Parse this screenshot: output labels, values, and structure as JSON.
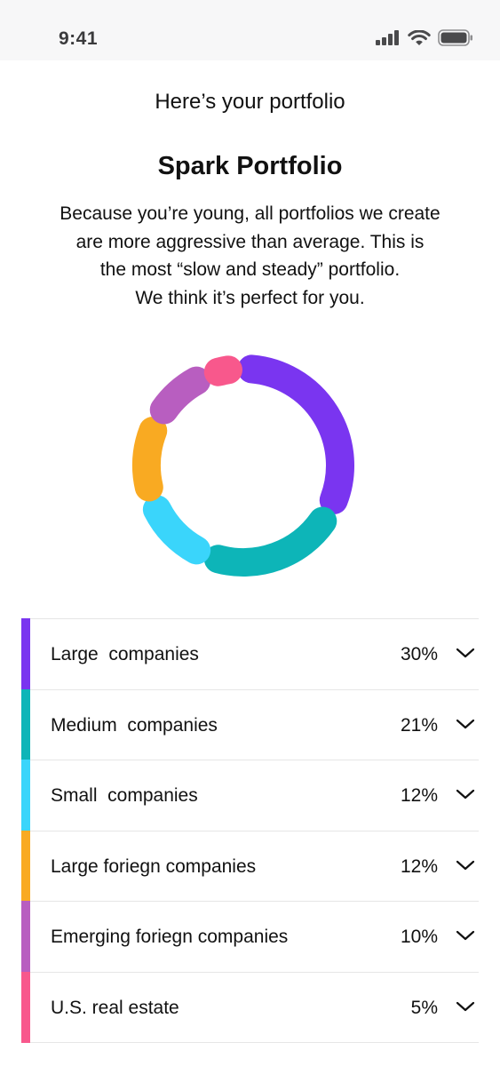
{
  "status": {
    "time": "9:41"
  },
  "header": {
    "title": "Here’s your portfolio"
  },
  "portfolio": {
    "name": "Spark Portfolio",
    "description_lines": [
      "Because you’re young, all portfolios we create",
      "are more aggressive than average. This is",
      "the most “slow and steady” portfolio.",
      "We think it’s perfect for you."
    ]
  },
  "icons": [
    "signal-icon",
    "wifi-icon",
    "battery-icon",
    "chevron-down-icon"
  ],
  "allocations": [
    {
      "label": "Large  companies",
      "percent": "30%",
      "color": "#7a35f0"
    },
    {
      "label": "Medium  companies",
      "percent": "21%",
      "color": "#0db5b8"
    },
    {
      "label": "Small  companies",
      "percent": "12%",
      "color": "#3ad5fb"
    },
    {
      "label": "Large foriegn companies",
      "percent": "12%",
      "color": "#f9aa22"
    },
    {
      "label": "Emerging foriegn companies",
      "percent": "10%",
      "color": "#b85ec0"
    },
    {
      "label": "U.S. real estate",
      "percent": "5%",
      "color": "#f8588c"
    }
  ]
}
